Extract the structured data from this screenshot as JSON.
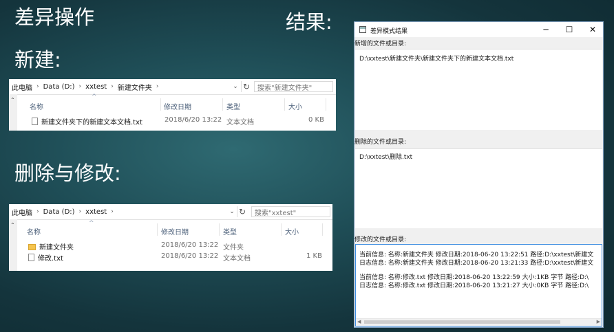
{
  "slide": {
    "heading": "差异操作",
    "result_label": "结果:",
    "create_label": "新建:",
    "delete_label": "删除与修改:"
  },
  "explorer_new": {
    "breadcrumb": [
      "此电脑",
      "Data (D:)",
      "xxtest",
      "新建文件夹"
    ],
    "search_placeholder": "搜索\"新建文件夹\"",
    "columns": [
      "名称",
      "修改日期",
      "类型",
      "大小"
    ],
    "rows": [
      {
        "icon": "text-file-icon",
        "name": "新建文件夹下的新建文本文档.txt",
        "date": "2018/6/20 13:22",
        "type": "文本文档",
        "size": "0 KB"
      }
    ]
  },
  "explorer_root": {
    "breadcrumb": [
      "此电脑",
      "Data (D:)",
      "xxtest"
    ],
    "search_placeholder": "搜索\"xxtest\"",
    "columns": [
      "名称",
      "修改日期",
      "类型",
      "大小"
    ],
    "rows": [
      {
        "icon": "folder-icon",
        "name": "新建文件夹",
        "date": "2018/6/20 13:22",
        "type": "文件夹",
        "size": ""
      },
      {
        "icon": "text-file-icon",
        "name": "修改.txt",
        "date": "2018/6/20 13:22",
        "type": "文本文档",
        "size": "1 KB"
      }
    ]
  },
  "result_window": {
    "title": "差异模式结果",
    "added_label": "新增的文件或目录:",
    "added_items": [
      "D:\\xxtest\\新建文件夹\\新建文件夹下的新建文本文档.txt"
    ],
    "deleted_label": "删除的文件或目录:",
    "deleted_items": [
      "D:\\xxtest\\删除.txt"
    ],
    "modified_label": "修改的文件或目录:",
    "modified_lines": [
      "当前信息:  名称:新建文件夹  修改日期:2018-06-20 13:22:51    路径:D:\\xxtest\\新建文",
      "日志信息:  名称:新建文件夹  修改日期:2018-06-20 13:21:33    路径:D:\\xxtest\\新建文",
      "当前信息:  名称:修改.txt 修改日期:2018-06-20 13:22:59 大小:1KB 字节   路径:D:\\",
      "日志信息:  名称:修改.txt 修改日期:2018-06-20 13:21:27 大小:0KB 字节   路径:D:\\"
    ]
  }
}
